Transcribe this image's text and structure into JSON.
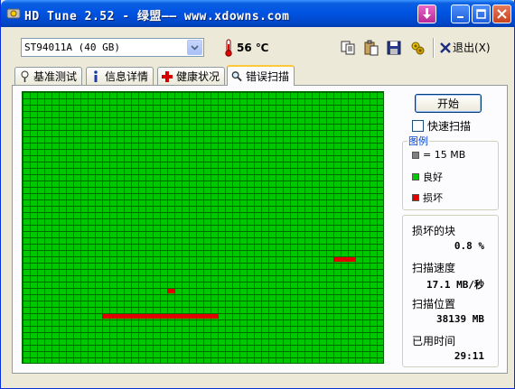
{
  "window": {
    "title": "HD Tune 2.52 - 绿盟—— www.xdowns.com"
  },
  "toolbar": {
    "drive": "ST94011A (40 GB)",
    "temperature": "56 ℃",
    "exit_label": "退出(X)"
  },
  "tabs": [
    {
      "label": "基准测试",
      "icon": "benchmark-icon"
    },
    {
      "label": "信息详情",
      "icon": "info-icon"
    },
    {
      "label": "健康状况",
      "icon": "health-cross-icon"
    },
    {
      "label": "错误扫描",
      "icon": "magnifier-icon",
      "active": true
    }
  ],
  "scan": {
    "start_label": "开始",
    "quick_scan_label": "快速扫描",
    "quick_scan_checked": false,
    "grid": {
      "columns": 50,
      "rows": 43
    },
    "bad_blocks": [
      {
        "row": 26,
        "col_start": 43,
        "col_end": 45
      },
      {
        "row": 31,
        "col_start": 20,
        "col_end": 20
      },
      {
        "row": 35,
        "col_start": 11,
        "col_end": 26
      }
    ]
  },
  "legend": {
    "title": "图例",
    "items": [
      {
        "label": "= 15 MB",
        "color": "#808080"
      },
      {
        "label": "良好",
        "color": "#00c800"
      },
      {
        "label": "损坏",
        "color": "#e00000"
      }
    ]
  },
  "stats": [
    {
      "label": "损坏的块",
      "value": "0.8 %"
    },
    {
      "label": "扫描速度",
      "value": "17.1 MB/秒"
    },
    {
      "label": "扫描位置",
      "value": "38139 MB"
    },
    {
      "label": "已用时间",
      "value": "29:11"
    }
  ]
}
